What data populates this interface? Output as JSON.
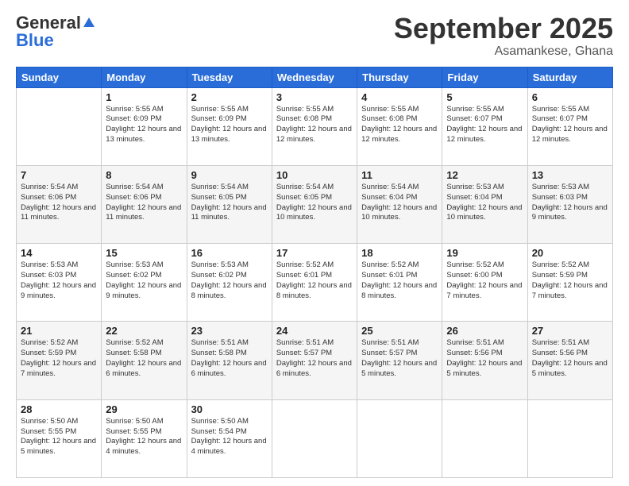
{
  "header": {
    "logo_general": "General",
    "logo_blue": "Blue",
    "month_title": "September 2025",
    "location": "Asamankese, Ghana"
  },
  "weekdays": [
    "Sunday",
    "Monday",
    "Tuesday",
    "Wednesday",
    "Thursday",
    "Friday",
    "Saturday"
  ],
  "weeks": [
    [
      {
        "day": "",
        "sunrise": "",
        "sunset": "",
        "daylight": ""
      },
      {
        "day": "1",
        "sunrise": "Sunrise: 5:55 AM",
        "sunset": "Sunset: 6:09 PM",
        "daylight": "Daylight: 12 hours and 13 minutes."
      },
      {
        "day": "2",
        "sunrise": "Sunrise: 5:55 AM",
        "sunset": "Sunset: 6:09 PM",
        "daylight": "Daylight: 12 hours and 13 minutes."
      },
      {
        "day": "3",
        "sunrise": "Sunrise: 5:55 AM",
        "sunset": "Sunset: 6:08 PM",
        "daylight": "Daylight: 12 hours and 12 minutes."
      },
      {
        "day": "4",
        "sunrise": "Sunrise: 5:55 AM",
        "sunset": "Sunset: 6:08 PM",
        "daylight": "Daylight: 12 hours and 12 minutes."
      },
      {
        "day": "5",
        "sunrise": "Sunrise: 5:55 AM",
        "sunset": "Sunset: 6:07 PM",
        "daylight": "Daylight: 12 hours and 12 minutes."
      },
      {
        "day": "6",
        "sunrise": "Sunrise: 5:55 AM",
        "sunset": "Sunset: 6:07 PM",
        "daylight": "Daylight: 12 hours and 12 minutes."
      }
    ],
    [
      {
        "day": "7",
        "sunrise": "Sunrise: 5:54 AM",
        "sunset": "Sunset: 6:06 PM",
        "daylight": "Daylight: 12 hours and 11 minutes."
      },
      {
        "day": "8",
        "sunrise": "Sunrise: 5:54 AM",
        "sunset": "Sunset: 6:06 PM",
        "daylight": "Daylight: 12 hours and 11 minutes."
      },
      {
        "day": "9",
        "sunrise": "Sunrise: 5:54 AM",
        "sunset": "Sunset: 6:05 PM",
        "daylight": "Daylight: 12 hours and 11 minutes."
      },
      {
        "day": "10",
        "sunrise": "Sunrise: 5:54 AM",
        "sunset": "Sunset: 6:05 PM",
        "daylight": "Daylight: 12 hours and 10 minutes."
      },
      {
        "day": "11",
        "sunrise": "Sunrise: 5:54 AM",
        "sunset": "Sunset: 6:04 PM",
        "daylight": "Daylight: 12 hours and 10 minutes."
      },
      {
        "day": "12",
        "sunrise": "Sunrise: 5:53 AM",
        "sunset": "Sunset: 6:04 PM",
        "daylight": "Daylight: 12 hours and 10 minutes."
      },
      {
        "day": "13",
        "sunrise": "Sunrise: 5:53 AM",
        "sunset": "Sunset: 6:03 PM",
        "daylight": "Daylight: 12 hours and 9 minutes."
      }
    ],
    [
      {
        "day": "14",
        "sunrise": "Sunrise: 5:53 AM",
        "sunset": "Sunset: 6:03 PM",
        "daylight": "Daylight: 12 hours and 9 minutes."
      },
      {
        "day": "15",
        "sunrise": "Sunrise: 5:53 AM",
        "sunset": "Sunset: 6:02 PM",
        "daylight": "Daylight: 12 hours and 9 minutes."
      },
      {
        "day": "16",
        "sunrise": "Sunrise: 5:53 AM",
        "sunset": "Sunset: 6:02 PM",
        "daylight": "Daylight: 12 hours and 8 minutes."
      },
      {
        "day": "17",
        "sunrise": "Sunrise: 5:52 AM",
        "sunset": "Sunset: 6:01 PM",
        "daylight": "Daylight: 12 hours and 8 minutes."
      },
      {
        "day": "18",
        "sunrise": "Sunrise: 5:52 AM",
        "sunset": "Sunset: 6:01 PM",
        "daylight": "Daylight: 12 hours and 8 minutes."
      },
      {
        "day": "19",
        "sunrise": "Sunrise: 5:52 AM",
        "sunset": "Sunset: 6:00 PM",
        "daylight": "Daylight: 12 hours and 7 minutes."
      },
      {
        "day": "20",
        "sunrise": "Sunrise: 5:52 AM",
        "sunset": "Sunset: 5:59 PM",
        "daylight": "Daylight: 12 hours and 7 minutes."
      }
    ],
    [
      {
        "day": "21",
        "sunrise": "Sunrise: 5:52 AM",
        "sunset": "Sunset: 5:59 PM",
        "daylight": "Daylight: 12 hours and 7 minutes."
      },
      {
        "day": "22",
        "sunrise": "Sunrise: 5:52 AM",
        "sunset": "Sunset: 5:58 PM",
        "daylight": "Daylight: 12 hours and 6 minutes."
      },
      {
        "day": "23",
        "sunrise": "Sunrise: 5:51 AM",
        "sunset": "Sunset: 5:58 PM",
        "daylight": "Daylight: 12 hours and 6 minutes."
      },
      {
        "day": "24",
        "sunrise": "Sunrise: 5:51 AM",
        "sunset": "Sunset: 5:57 PM",
        "daylight": "Daylight: 12 hours and 6 minutes."
      },
      {
        "day": "25",
        "sunrise": "Sunrise: 5:51 AM",
        "sunset": "Sunset: 5:57 PM",
        "daylight": "Daylight: 12 hours and 5 minutes."
      },
      {
        "day": "26",
        "sunrise": "Sunrise: 5:51 AM",
        "sunset": "Sunset: 5:56 PM",
        "daylight": "Daylight: 12 hours and 5 minutes."
      },
      {
        "day": "27",
        "sunrise": "Sunrise: 5:51 AM",
        "sunset": "Sunset: 5:56 PM",
        "daylight": "Daylight: 12 hours and 5 minutes."
      }
    ],
    [
      {
        "day": "28",
        "sunrise": "Sunrise: 5:50 AM",
        "sunset": "Sunset: 5:55 PM",
        "daylight": "Daylight: 12 hours and 5 minutes."
      },
      {
        "day": "29",
        "sunrise": "Sunrise: 5:50 AM",
        "sunset": "Sunset: 5:55 PM",
        "daylight": "Daylight: 12 hours and 4 minutes."
      },
      {
        "day": "30",
        "sunrise": "Sunrise: 5:50 AM",
        "sunset": "Sunset: 5:54 PM",
        "daylight": "Daylight: 12 hours and 4 minutes."
      },
      {
        "day": "",
        "sunrise": "",
        "sunset": "",
        "daylight": ""
      },
      {
        "day": "",
        "sunrise": "",
        "sunset": "",
        "daylight": ""
      },
      {
        "day": "",
        "sunrise": "",
        "sunset": "",
        "daylight": ""
      },
      {
        "day": "",
        "sunrise": "",
        "sunset": "",
        "daylight": ""
      }
    ]
  ]
}
